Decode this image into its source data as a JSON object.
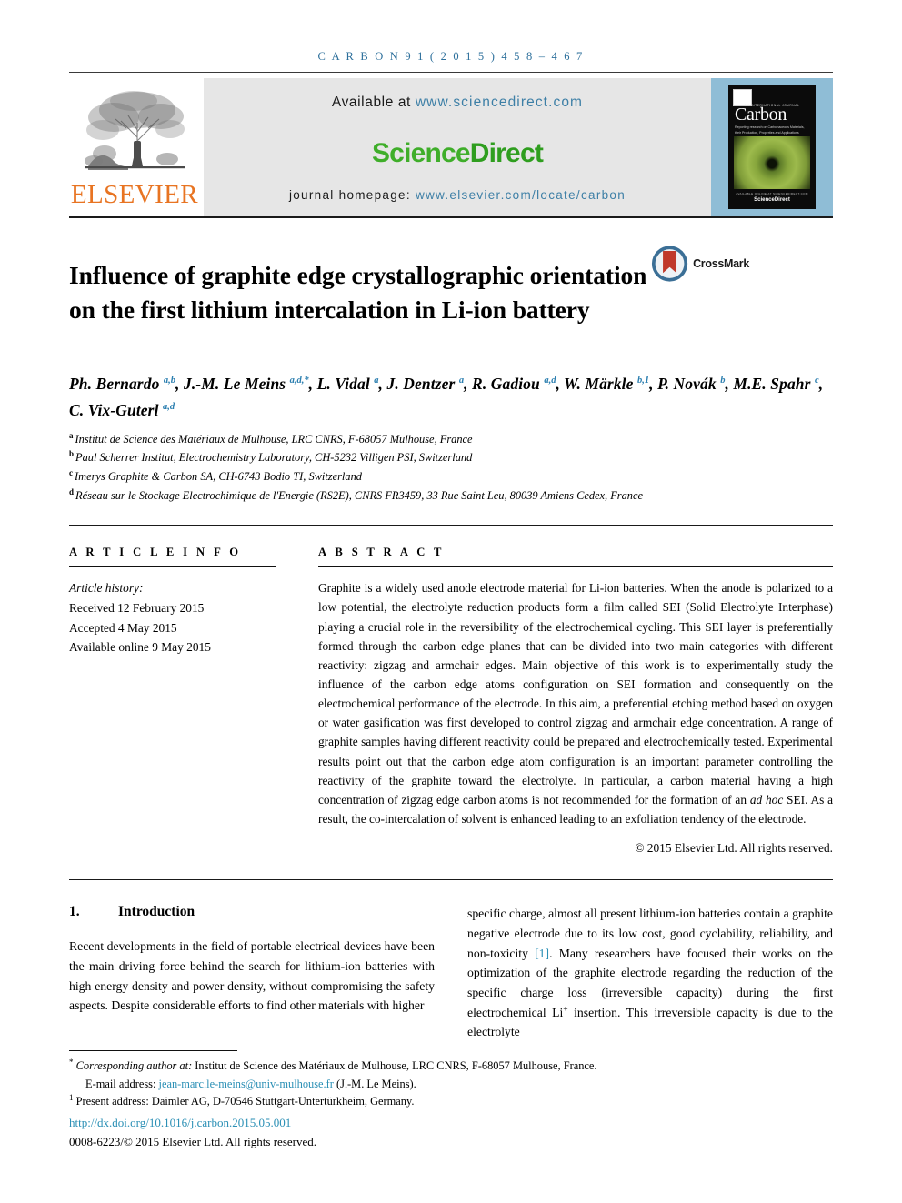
{
  "running_head": "C A R B O N   9 1   ( 2 0 1 5 )   4 5 8 – 4 6 7",
  "masthead": {
    "publisher_name": "ELSEVIER",
    "available_prefix": "Available at",
    "sciencedirect_url": "www.sciencedirect.com",
    "sciencedirect_logo_a": "Science",
    "sciencedirect_logo_b": "Direct",
    "homepage_label": "journal homepage:",
    "homepage_url": "www.elsevier.com/locate/carbon",
    "cover": {
      "kicker": "AN INTERNATIONAL JOURNAL",
      "title": "Carbon",
      "subtitle": "Reporting research on Carbonaceous Materials, their Production, Properties and Applications",
      "footer_top": "AVAILABLE ONLINE AT SCIENCEDIRECT.COM",
      "footer_brand": "ScienceDirect"
    }
  },
  "article": {
    "title": "Influence of graphite edge crystallographic orientation on the first lithium intercalation in Li-ion battery",
    "crossmark_label": "CrossMark",
    "authors_html": "Ph. Bernardo <sup>a,b</sup>, J.-M. Le Meins <sup>a,d,*</sup>, L. Vidal <sup>a</sup>, J. Dentzer <sup>a</sup>, R. Gadiou <sup>a,d</sup>, W. Märkle <sup>b,1</sup>, P. Novák <sup>b</sup>, M.E. Spahr <sup>c</sup>, C. Vix-Guterl <sup>a,d</sup>",
    "affiliations": [
      {
        "marker": "a",
        "text": "Institut de Science des Matériaux de Mulhouse, LRC CNRS, F-68057 Mulhouse, France"
      },
      {
        "marker": "b",
        "text": "Paul Scherrer Institut, Electrochemistry Laboratory, CH-5232 Villigen PSI, Switzerland"
      },
      {
        "marker": "c",
        "text": "Imerys Graphite & Carbon SA, CH-6743 Bodio TI, Switzerland"
      },
      {
        "marker": "d",
        "text": "Réseau sur le Stockage Electrochimique de l'Energie (RS2E), CNRS FR3459, 33 Rue Saint Leu, 80039 Amiens Cedex, France"
      }
    ]
  },
  "article_info": {
    "heading": "A R T I C L E   I N F O",
    "history_label": "Article history:",
    "history": [
      "Received 12 February 2015",
      "Accepted 4 May 2015",
      "Available online 9 May 2015"
    ]
  },
  "abstract": {
    "heading": "A B S T R A C T",
    "paragraph_html": "Graphite is a widely used anode electrode material for Li-ion batteries. When the anode is polarized to a low potential, the electrolyte reduction products form a film called SEI (Solid Electrolyte Interphase) playing a crucial role in the reversibility of the electrochemical cycling. This SEI layer is preferentially formed through the carbon edge planes that can be divided into two main categories with different reactivity: zigzag and armchair edges. Main objective of this work is to experimentally study the influence of the carbon edge atoms configuration on SEI formation and consequently on the electrochemical performance of the electrode. In this aim, a preferential etching method based on oxygen or water gasification was first developed to control zigzag and armchair edge concentration. A range of graphite samples having different reactivity could be prepared and electrochemically tested. Experimental results point out that the carbon edge atom configuration is an important parameter controlling the reactivity of the graphite toward the electrolyte. In particular, a carbon material having a high concentration of zigzag edge carbon atoms is not recommended for the formation of an <em>ad hoc</em> SEI. As a result, the co-intercalation of solvent is enhanced leading to an exfoliation tendency of the electrode.",
    "copyright": "© 2015 Elsevier Ltd. All rights reserved."
  },
  "introduction": {
    "number": "1.",
    "title": "Introduction",
    "left_column_html": "Recent developments in the field of portable electrical devices have been the main driving force behind the search for lithium-ion batteries with high energy density and power density, without compromising the safety aspects. Despite considerable efforts to find other materials with higher",
    "right_column_html": "specific charge, almost all present lithium-ion batteries contain a graphite negative electrode due to its low cost, good cyclability, reliability, and non-toxicity <span class=\"cite\">[1]</span>. Many researchers have focused their works on the optimization of the graphite electrode regarding the reduction of the specific charge loss (irreversible capacity) during the first electrochemical Li<sup>+</sup> insertion. This irreversible capacity is due to the electrolyte"
  },
  "footnotes": {
    "corresponding_html": "<sup>*</sup> <span class=\"it\">Corresponding author at:</span> Institut de Science des Matériaux de Mulhouse, LRC CNRS, F-68057 Mulhouse, France.",
    "email_html": "E-mail address: <span class=\"lnk\">jean-marc.le-meins@univ-mulhouse.fr</span> (J.-M. Le Meins).",
    "present_address_html": "<sup>1</sup> Present address: Daimler AG, D-70546 Stuttgart-Untertürkheim, Germany.",
    "doi": "http://dx.doi.org/10.1016/j.carbon.2015.05.001",
    "issn_line": "0008-6223/© 2015 Elsevier Ltd. All rights reserved."
  }
}
